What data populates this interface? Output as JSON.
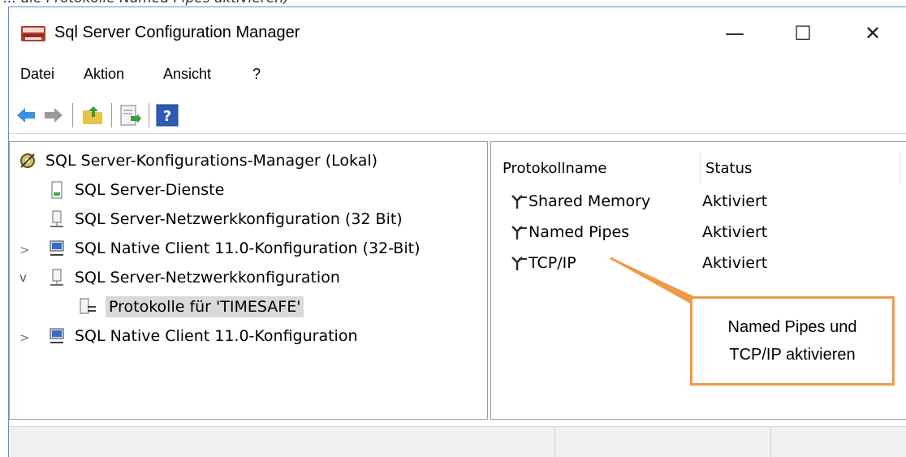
{
  "caption_fragment": "... die Protokolle Named Pipes aktivieren)",
  "window": {
    "title": "Sql Server Configuration Manager",
    "controls": {
      "minimize": "—",
      "maximize": "☐",
      "close": "✕"
    }
  },
  "menu": [
    "Datei",
    "Aktion",
    "Ansicht",
    "?"
  ],
  "toolbar": [
    "back-arrow-icon",
    "forward-arrow-icon",
    "up-folder-icon",
    "export-list-icon",
    "help-icon"
  ],
  "tree": {
    "root": "SQL Server-Konfigurations-Manager (Lokal)",
    "items": [
      {
        "label": "SQL Server-Dienste",
        "expander": ""
      },
      {
        "label": "SQL Server-Netzwerkkonfiguration (32 Bit)",
        "expander": ""
      },
      {
        "label": "SQL Native Client 11.0-Konfiguration (32-Bit)",
        "expander": ">"
      },
      {
        "label": "SQL Server-Netzwerkkonfiguration",
        "expander": "v"
      },
      {
        "label": "Protokolle für 'TIMESAFE'",
        "expander": "",
        "selected": true
      },
      {
        "label": "SQL Native Client 11.0-Konfiguration",
        "expander": ">"
      }
    ]
  },
  "list": {
    "columns": [
      "Protokollname",
      "Status"
    ],
    "rows": [
      {
        "name": "Shared Memory",
        "status": "Aktiviert"
      },
      {
        "name": "Named Pipes",
        "status": "Aktiviert"
      },
      {
        "name": "TCP/IP",
        "status": "Aktiviert"
      }
    ]
  },
  "callout": {
    "line1": "Named Pipes und",
    "line2": "TCP/IP aktivieren",
    "border_color": "#ED9B4A"
  }
}
